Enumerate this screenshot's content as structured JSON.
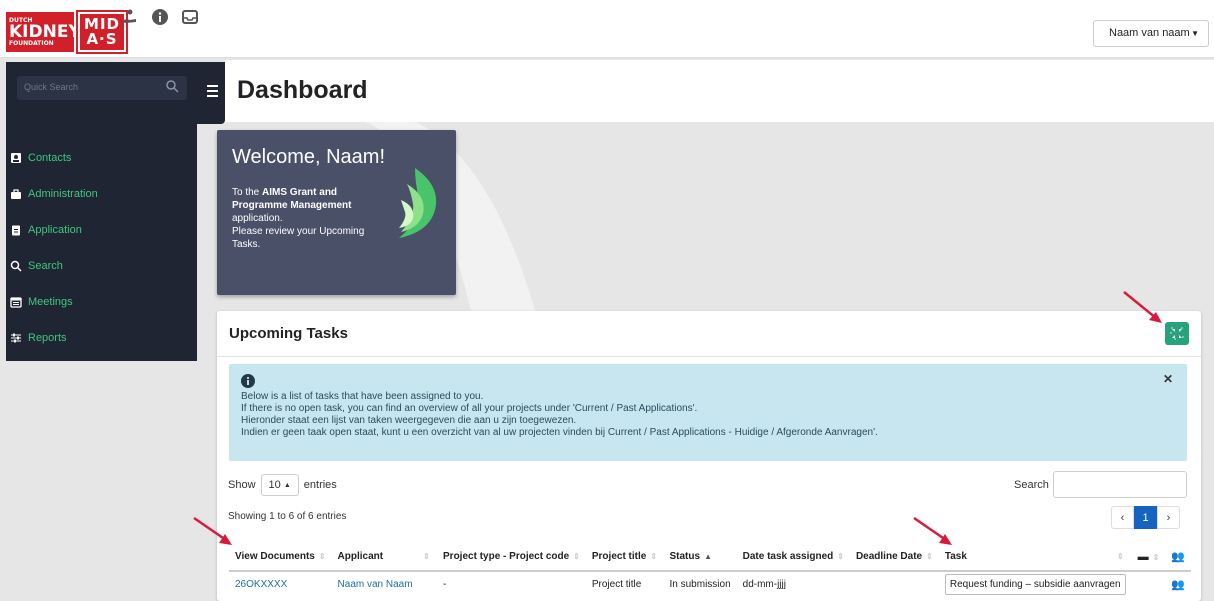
{
  "topbar": {
    "logo_kidney_small": "DUTCH",
    "logo_kidney_main": "KIDNEY",
    "logo_kidney_sub": "FOUNDATION",
    "logo_midas_top": "MID",
    "logo_midas_bottom": "A·S",
    "icons": [
      "hand-coin-icon",
      "info-circle-icon",
      "inbox-icon"
    ],
    "user_label": "Naam van naam"
  },
  "sidebar": {
    "search_placeholder": "Quick Search",
    "items": [
      {
        "label": "Contacts",
        "icon": "contact-card-icon"
      },
      {
        "label": "Administration",
        "icon": "briefcase-icon"
      },
      {
        "label": "Application",
        "icon": "clipboard-icon"
      },
      {
        "label": "Search",
        "icon": "search-icon"
      },
      {
        "label": "Meetings",
        "icon": "calendar-icon"
      },
      {
        "label": "Reports",
        "icon": "sliders-icon"
      }
    ]
  },
  "header": {
    "title": "Dashboard"
  },
  "welcome": {
    "title": "Welcome,  Naam!",
    "line1": "To the ",
    "bold": "AIMS Grant and Programme Management",
    "line2": " application.",
    "line3": "Please review your Upcoming Tasks."
  },
  "tasks": {
    "title": "Upcoming Tasks",
    "alert_lines": [
      "Below is a list of tasks that have been assigned to you.",
      "If there is no open task, you can find an overview of all your projects under 'Current / Past Applications'.",
      "Hieronder staat een lijst van taken weergegeven die aan u zijn toegewezen.",
      "Indien er geen taak open staat, kunt u een overzicht van al uw projecten vinden bij Current / Past Applications - Huidige / Afgeronde Aanvragen'."
    ],
    "show_label": "Show",
    "entries_value": "10",
    "entries_label": "entries",
    "search_label": "Search",
    "info": "Showing 1 to 6 of 6 entries",
    "pager": {
      "prev": "‹",
      "current": "1",
      "next": "›"
    },
    "columns": [
      "View Documents",
      "Applicant",
      "Project type - Project code",
      "Project title",
      "Status",
      "Date task assigned",
      "Deadline Date",
      "Task"
    ],
    "rows": [
      {
        "documents": "26OKXXXX",
        "applicant": "Naam van Naam",
        "project_type": "-",
        "project_title": "Project title",
        "status": "In submission",
        "date_assigned": "dd-mm-jjjj",
        "deadline": "",
        "task": "Request funding – subsidie aanvragen"
      }
    ]
  },
  "colors": {
    "sidebar_bg": "#1f2533",
    "nav_green": "#3ec77e",
    "welcome_bg": "#4a5068",
    "alert_bg": "#c7e6ef",
    "accent_green": "#26a37a",
    "annotation_red": "#d81b3c",
    "logo_red": "#d2202a"
  }
}
